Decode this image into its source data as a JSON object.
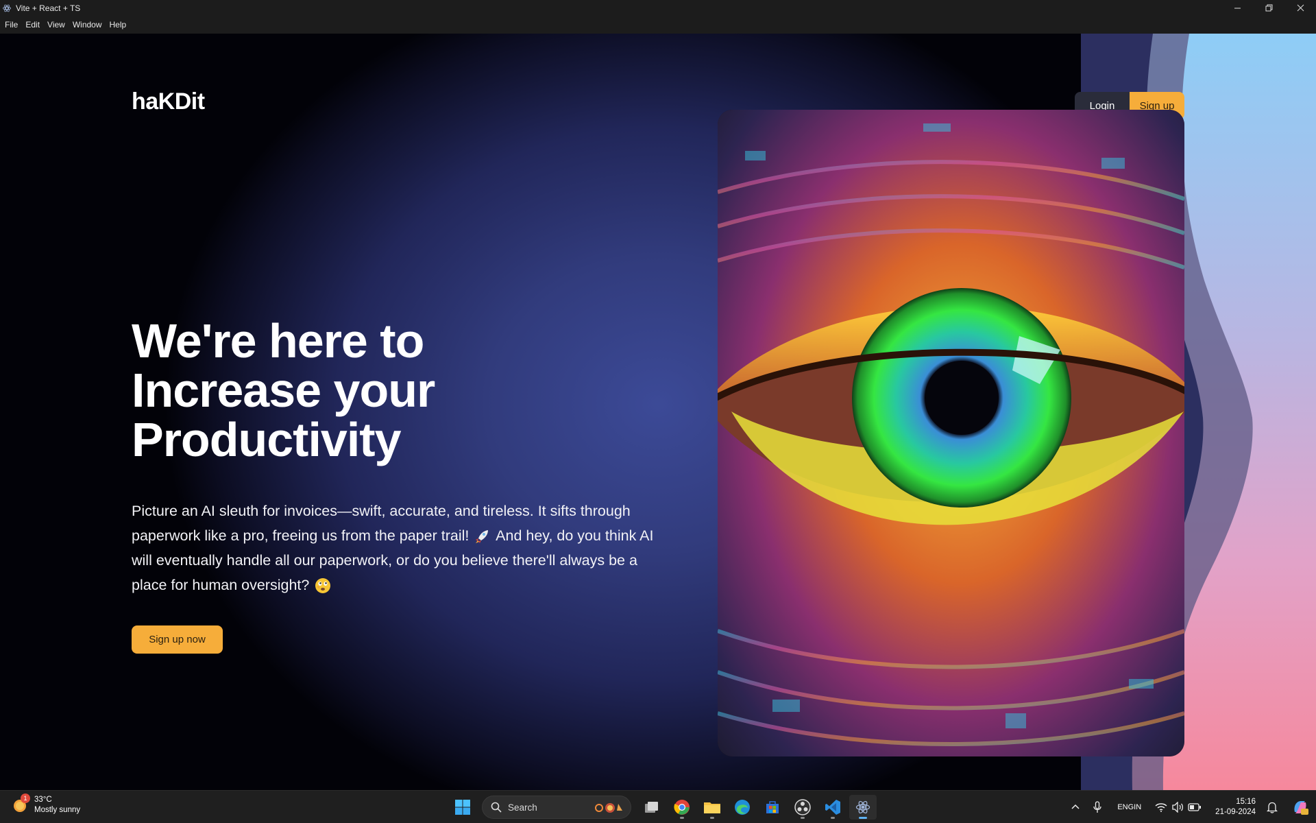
{
  "window": {
    "title": "Vite + React + TS",
    "menu": [
      "File",
      "Edit",
      "View",
      "Window",
      "Help"
    ]
  },
  "page": {
    "logo": "haKDit",
    "nav": {
      "login_label": "Login",
      "signup_label": "Sign up"
    },
    "hero": {
      "title_lines": [
        "We're here to",
        "Increase your",
        "Productivity"
      ],
      "body_part1": "Picture an AI sleuth for invoices—swift, accurate, and tireless. It sifts through paperwork like a pro, freeing us from the paper trail!",
      "body_part2": "And hey, do you think AI will eventually handle all our paperwork, or do you believe there'll always be a place for human oversight?",
      "cta_label": "Sign up now",
      "image_icon": "green-eye-artwork"
    },
    "colors": {
      "accent": "#f6ad3a",
      "login_bg": "#2a2c3a",
      "background_center": "#3c4a97"
    }
  },
  "taskbar": {
    "weather": {
      "temp": "33°C",
      "condition": "Mostly sunny",
      "badge": "1"
    },
    "search_placeholder": "Search",
    "apps": [
      "start-icon",
      "task-view-icon",
      "chrome-icon",
      "file-explorer-icon",
      "edge-icon",
      "store-icon",
      "obs-icon",
      "vscode-icon",
      "electron-app-icon"
    ],
    "tray": {
      "lang_line1": "ENG",
      "lang_line2": "IN",
      "time": "15:16",
      "date": "21-09-2024"
    }
  }
}
